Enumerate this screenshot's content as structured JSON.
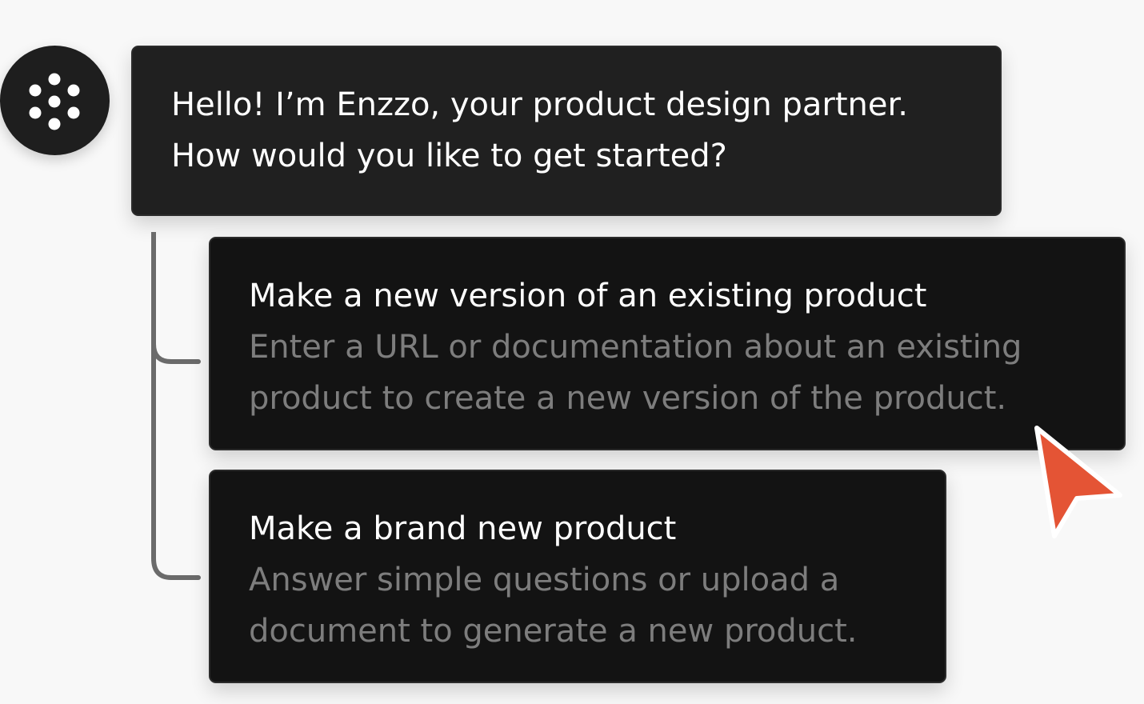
{
  "assistant": {
    "avatar_icon": "dots-logo-icon",
    "message_lines": [
      "Hello! I’m Enzzo, your product design partner.",
      "How would you like to get started?"
    ]
  },
  "options": [
    {
      "title": "Make a new version of an existing product",
      "description_lines": [
        "Enter a URL or documentation about an existing",
        "product to create a new version of the product."
      ]
    },
    {
      "title": "Make a brand new product",
      "description_lines": [
        "Answer simple questions or upload a",
        "document to generate a new product."
      ]
    }
  ],
  "cursor": {
    "icon": "pointer-arrow-icon",
    "color": "#e45435"
  },
  "colors": {
    "card_background": "#191919",
    "primary_text": "#ffffff",
    "secondary_text": "#7d7d7d",
    "connector": "#6b6b6b"
  }
}
